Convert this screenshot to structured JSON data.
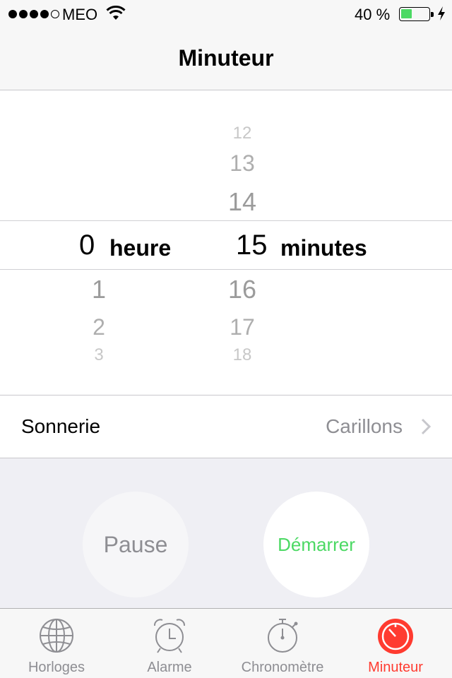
{
  "status_bar": {
    "signal_filled": 4,
    "signal_total": 5,
    "carrier": "MEO",
    "wifi_icon": "wifi-icon",
    "battery_text": "40 %",
    "battery_level": 0.4,
    "battery_color": "#4cd964",
    "charging_icon": "bolt-icon"
  },
  "nav": {
    "title": "Minuteur"
  },
  "picker": {
    "hours": {
      "above": [],
      "selected": "0",
      "unit": "heure",
      "below": [
        "1",
        "2",
        "3"
      ]
    },
    "minutes": {
      "above": [
        "12",
        "13",
        "14"
      ],
      "selected": "15",
      "unit": "minutes",
      "below": [
        "16",
        "17",
        "18"
      ]
    }
  },
  "sound": {
    "label": "Sonnerie",
    "value": "Carillons",
    "chevron_icon": "chevron-right-icon"
  },
  "buttons": {
    "pause": "Pause",
    "start": "Démarrer",
    "start_color": "#4cd964"
  },
  "tabs": [
    {
      "label": "Horloges",
      "icon": "globe-icon",
      "active": false
    },
    {
      "label": "Alarme",
      "icon": "alarm-clock-icon",
      "active": false
    },
    {
      "label": "Chronomètre",
      "icon": "stopwatch-icon",
      "active": false
    },
    {
      "label": "Minuteur",
      "icon": "timer-icon",
      "active": true
    }
  ],
  "colors": {
    "accent": "#ff3b30",
    "inactive": "#8e8e93"
  }
}
